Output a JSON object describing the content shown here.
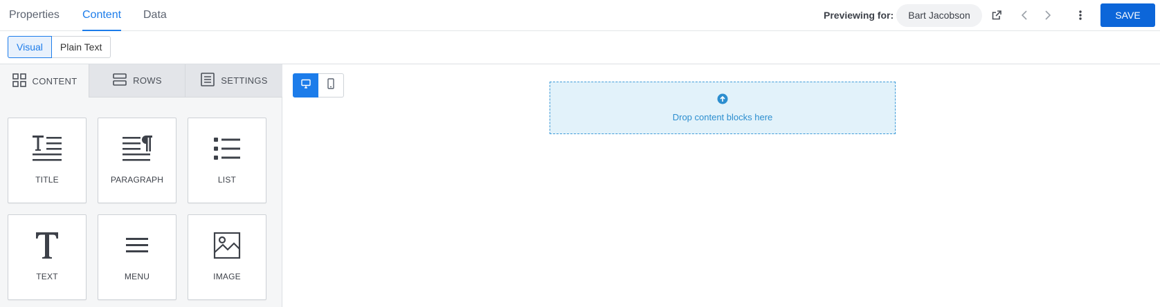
{
  "header": {
    "tabs": [
      {
        "label": "Properties",
        "active": false
      },
      {
        "label": "Content",
        "active": true
      },
      {
        "label": "Data",
        "active": false
      }
    ],
    "preview_label": "Previewing for:",
    "preview_user": "Bart Jacobson",
    "save_label": "SAVE",
    "accent_color": "#1c7cea",
    "save_color": "#0c66d9"
  },
  "mode": {
    "options": [
      {
        "label": "Visual",
        "active": true
      },
      {
        "label": "Plain Text",
        "active": false
      }
    ]
  },
  "panel": {
    "tabs": [
      {
        "label": "CONTENT",
        "icon": "grid-icon",
        "active": true
      },
      {
        "label": "ROWS",
        "icon": "rows-icon",
        "active": false
      },
      {
        "label": "SETTINGS",
        "icon": "settings-icon",
        "active": false
      }
    ],
    "blocks": [
      {
        "label": "TITLE",
        "icon": "title-icon"
      },
      {
        "label": "PARAGRAPH",
        "icon": "paragraph-icon"
      },
      {
        "label": "LIST",
        "icon": "list-icon"
      },
      {
        "label": "TEXT",
        "icon": "text-icon"
      },
      {
        "label": "MENU",
        "icon": "menu-icon"
      },
      {
        "label": "IMAGE",
        "icon": "image-icon"
      }
    ]
  },
  "canvas": {
    "devices": [
      {
        "icon": "desktop-icon",
        "active": true
      },
      {
        "icon": "mobile-icon",
        "active": false
      }
    ],
    "dropzone_text": "Drop content blocks here"
  }
}
